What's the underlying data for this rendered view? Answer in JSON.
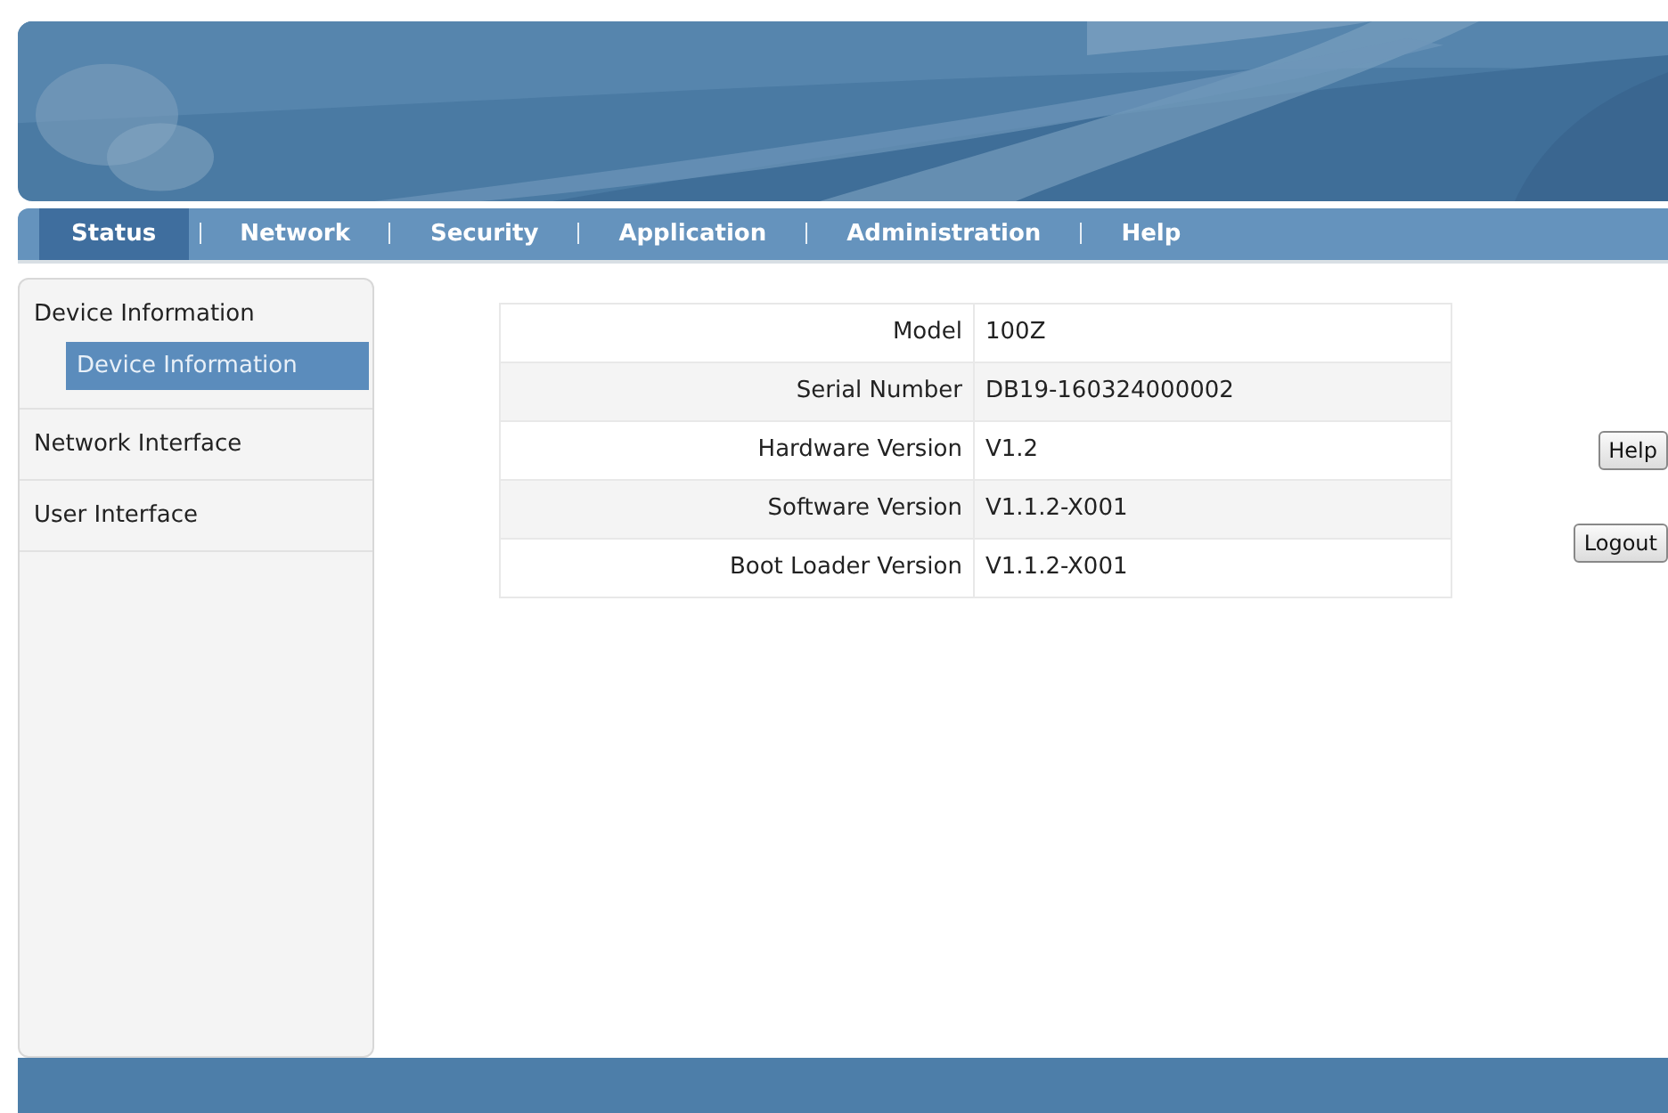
{
  "banner": {
    "kind": "picture"
  },
  "nav": [
    {
      "label": "Status",
      "selected": true
    },
    {
      "label": "Network",
      "selected": false
    },
    {
      "label": "Security",
      "selected": false
    },
    {
      "label": "Application",
      "selected": false
    },
    {
      "label": "Administration",
      "selected": false
    },
    {
      "label": "Help",
      "selected": false
    }
  ],
  "sidebar": {
    "items": [
      {
        "label": "Device Information",
        "children": [
          {
            "label": "Device Information",
            "selected": true
          }
        ]
      },
      {
        "label": "Network Interface"
      },
      {
        "label": "User Interface"
      }
    ]
  },
  "table": {
    "rows": [
      {
        "label": "Model",
        "value": "100Z"
      },
      {
        "label": "Serial Number",
        "value": "DB19-160324000002"
      },
      {
        "label": "Hardware Version",
        "value": "V1.2"
      },
      {
        "label": "Software Version",
        "value": "V1.1.2-X001"
      },
      {
        "label": "Boot Loader Version",
        "value": "V1.1.2-X001"
      }
    ]
  },
  "buttons": [
    "Help",
    "Logout"
  ]
}
